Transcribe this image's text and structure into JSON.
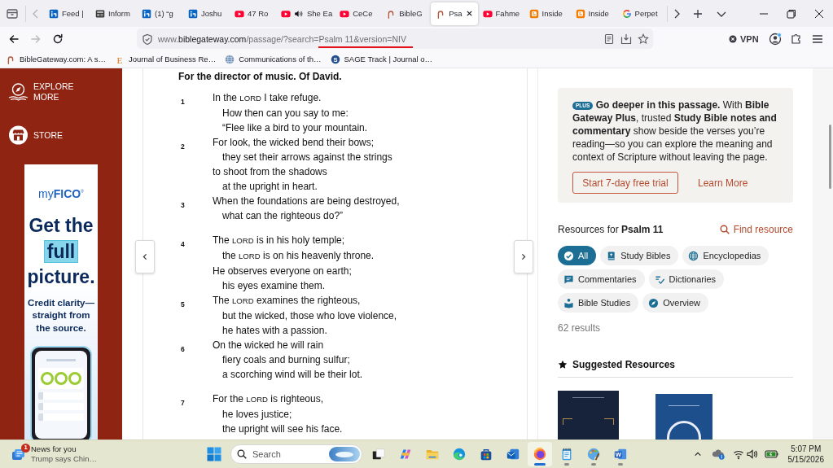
{
  "browser": {
    "tabs": [
      {
        "kind": "linkedin",
        "title": "Feed |",
        "selected": false,
        "audio": false
      },
      {
        "kind": "news",
        "title": "Inform",
        "selected": false,
        "audio": false
      },
      {
        "kind": "linkedin",
        "title": "(1) “g",
        "selected": false,
        "audio": false
      },
      {
        "kind": "linkedin",
        "title": "Joshu",
        "selected": false,
        "audio": false
      },
      {
        "kind": "youtube",
        "title": "47 Ro",
        "selected": false,
        "audio": false
      },
      {
        "kind": "youtube",
        "title": "She Ea",
        "selected": false,
        "audio": true
      },
      {
        "kind": "youtube",
        "title": "CeCe",
        "selected": false,
        "audio": false
      },
      {
        "kind": "biblegateway",
        "title": "BibleG",
        "selected": false,
        "audio": false
      },
      {
        "kind": "biblegateway",
        "title": "Psa",
        "selected": true,
        "audio": false
      },
      {
        "kind": "youtube",
        "title": "Fahme",
        "selected": false,
        "audio": false
      },
      {
        "kind": "blogger",
        "title": "Inside",
        "selected": false,
        "audio": false
      },
      {
        "kind": "blogger",
        "title": "Inside",
        "selected": false,
        "audio": false
      },
      {
        "kind": "google",
        "title": "Perpet",
        "selected": false,
        "audio": false
      }
    ],
    "nav_buttons": [
      {
        "kind": "back",
        "disabled": false
      },
      {
        "kind": "forward",
        "disabled": true
      },
      {
        "kind": "reload",
        "disabled": false
      }
    ],
    "address_bar": {
      "url_parts": [
        {
          "text": "www.",
          "kind": "muted",
          "underlined": false
        },
        {
          "text": "biblegateway.com",
          "kind": "domain",
          "underlined": false
        },
        {
          "text": "/passage/?search=",
          "kind": "muted",
          "underlined": false
        },
        {
          "text": "Psalm 11&version=NIV",
          "kind": "muted",
          "underlined": true
        }
      ]
    },
    "toolbar": {
      "vpn_label": "VPN",
      "account_badge": true
    },
    "bookmarks": [
      {
        "kind": "biblegateway",
        "title": "BibleGateway.com: A s…"
      },
      {
        "kind": "journal-e",
        "glyph": "E",
        "title": "Journal of Business Re…"
      },
      {
        "kind": "globe",
        "title": "Communications of th…"
      },
      {
        "kind": "sage",
        "glyph": "S",
        "title": "SAGE Track | Journal o…"
      }
    ]
  },
  "sidebar": {
    "items": [
      {
        "kind": "explore",
        "label": "EXPLORE MORE"
      },
      {
        "kind": "store",
        "label": "STORE"
      }
    ],
    "ad": {
      "brand": "my**FICO**$^{®}$",
      "headline": [
        {
          "text": "Get the",
          "highlight": false
        },
        {
          "text": "full",
          "highlight": true
        },
        {
          "text": "picture.",
          "highlight": false
        }
      ],
      "tagline": "Credit clarity—straight from the source."
    }
  },
  "passage": {
    "heading": "For the director of music. Of David.",
    "stanzas": [
      {
        "verses": [
          {
            "number": "1",
            "lines": [
              {
                "kind": "flush",
                "parts": [
                  {
                    "text": "In the ",
                    "kind": "plain"
                  },
                  {
                    "text": "LORD",
                    "kind": "divine-name"
                  },
                  {
                    "text": " I take refuge.",
                    "kind": "plain"
                  }
                ]
              },
              {
                "kind": "indented",
                "parts": [
                  {
                    "text": "How then can you say to me:",
                    "kind": "plain"
                  }
                ]
              },
              {
                "kind": "indented",
                "parts": [
                  {
                    "text": "“Flee like a bird to your mountain.",
                    "kind": "plain"
                  }
                ]
              }
            ]
          },
          {
            "number": "2",
            "lines": [
              {
                "kind": "flush",
                "parts": [
                  {
                    "text": "For look, the wicked bend their bows;",
                    "kind": "plain"
                  }
                ]
              },
              {
                "kind": "indented",
                "parts": [
                  {
                    "text": "they set their arrows against the strings",
                    "kind": "plain"
                  }
                ]
              },
              {
                "kind": "flush",
                "parts": [
                  {
                    "text": "to shoot from the shadows",
                    "kind": "plain"
                  }
                ]
              },
              {
                "kind": "indented",
                "parts": [
                  {
                    "text": "at the upright in heart.",
                    "kind": "plain"
                  }
                ]
              }
            ]
          },
          {
            "number": "3",
            "lines": [
              {
                "kind": "flush",
                "parts": [
                  {
                    "text": "When the foundations are being destroyed,",
                    "kind": "plain"
                  }
                ]
              },
              {
                "kind": "indented",
                "parts": [
                  {
                    "text": "what can the righteous do?”",
                    "kind": "plain"
                  }
                ]
              }
            ]
          }
        ]
      },
      {
        "verses": [
          {
            "number": "4",
            "lines": [
              {
                "kind": "flush",
                "parts": [
                  {
                    "text": "The ",
                    "kind": "plain"
                  },
                  {
                    "text": "LORD",
                    "kind": "divine-name"
                  },
                  {
                    "text": " is in his holy temple;",
                    "kind": "plain"
                  }
                ]
              },
              {
                "kind": "indented",
                "parts": [
                  {
                    "text": "the ",
                    "kind": "plain"
                  },
                  {
                    "text": "LORD",
                    "kind": "divine-name"
                  },
                  {
                    "text": " is on his heavenly throne.",
                    "kind": "plain"
                  }
                ]
              },
              {
                "kind": "flush",
                "parts": [
                  {
                    "text": "He observes everyone on earth;",
                    "kind": "plain"
                  }
                ]
              },
              {
                "kind": "indented",
                "parts": [
                  {
                    "text": "his eyes examine them.",
                    "kind": "plain"
                  }
                ]
              }
            ]
          },
          {
            "number": "5",
            "lines": [
              {
                "kind": "flush",
                "parts": [
                  {
                    "text": "The ",
                    "kind": "plain"
                  },
                  {
                    "text": "LORD",
                    "kind": "divine-name"
                  },
                  {
                    "text": " examines the righteous,",
                    "kind": "plain"
                  }
                ]
              },
              {
                "kind": "indented",
                "parts": [
                  {
                    "text": "but the wicked, those who love violence,",
                    "kind": "plain"
                  }
                ]
              },
              {
                "kind": "indented",
                "parts": [
                  {
                    "text": "he hates with a passion.",
                    "kind": "plain"
                  }
                ]
              }
            ]
          },
          {
            "number": "6",
            "lines": [
              {
                "kind": "flush",
                "parts": [
                  {
                    "text": "On the wicked he will rain",
                    "kind": "plain"
                  }
                ]
              },
              {
                "kind": "indented",
                "parts": [
                  {
                    "text": "fiery coals and burning sulfur;",
                    "kind": "plain"
                  }
                ]
              },
              {
                "kind": "indented",
                "parts": [
                  {
                    "text": "a scorching wind will be their lot.",
                    "kind": "plain"
                  }
                ]
              }
            ]
          }
        ]
      },
      {
        "verses": [
          {
            "number": "7",
            "lines": [
              {
                "kind": "flush",
                "parts": [
                  {
                    "text": "For the ",
                    "kind": "plain"
                  },
                  {
                    "text": "LORD",
                    "kind": "divine-name"
                  },
                  {
                    "text": " is righteous,",
                    "kind": "plain"
                  }
                ]
              },
              {
                "kind": "indented",
                "parts": [
                  {
                    "text": "he loves justice;",
                    "kind": "plain"
                  }
                ]
              },
              {
                "kind": "indented",
                "parts": [
                  {
                    "text": "the upright will see his face.",
                    "kind": "plain"
                  }
                ]
              }
            ]
          }
        ]
      }
    ]
  },
  "resources": {
    "promo": {
      "badge": "PLUS",
      "text": "**Go deeper in this passage.** With **Bible Gateway Plus**, trusted **Study Bible notes and commentary** show beside the verses you’re reading—so you can explore the meaning and context of Scripture without leaving the page.",
      "primary_button": "Start 7-day free trial",
      "link": "Learn More"
    },
    "heading": "Resources for **Psalm 11**",
    "find_link": "Find resource",
    "filters": [
      {
        "kind": "check",
        "label": "All",
        "selected": true
      },
      {
        "kind": "book",
        "label": "Study Bibles",
        "selected": false
      },
      {
        "kind": "globe",
        "label": "Encyclopedias",
        "selected": false
      },
      {
        "kind": "comment",
        "label": "Commentaries",
        "selected": false
      },
      {
        "kind": "dictionary",
        "label": "Dictionaries",
        "selected": false
      },
      {
        "kind": "reader",
        "label": "Bible Studies",
        "selected": false
      },
      {
        "kind": "compass",
        "label": "Overview",
        "selected": false
      }
    ],
    "results": "62 results",
    "suggested": {
      "title": "Suggested Resources",
      "items": [
        {
          "kind": "ornate"
        },
        {
          "kind": "emblem"
        }
      ]
    }
  },
  "taskbar": {
    "news": {
      "badge": "1",
      "title": "News for you",
      "subtitle": "Trump says Chin…"
    },
    "search": {
      "placeholder": "Search"
    },
    "apps": [
      {
        "kind": "task-view",
        "running": false,
        "selected": false
      },
      {
        "kind": "copilot",
        "running": false,
        "selected": false
      },
      {
        "kind": "explorer",
        "running": false,
        "selected": false
      },
      {
        "kind": "edge",
        "running": false,
        "selected": false
      },
      {
        "kind": "store",
        "running": false,
        "selected": false
      },
      {
        "kind": "outlook",
        "running": false,
        "selected": false
      },
      {
        "kind": "firefox",
        "running": true,
        "selected": true
      },
      {
        "kind": "notepad",
        "running": true,
        "selected": false
      },
      {
        "kind": "paint",
        "running": true,
        "selected": false
      },
      {
        "kind": "word",
        "glyph": "W",
        "running": true,
        "selected": false
      }
    ],
    "clock": {
      "time": "5:07 PM",
      "date": "5/15/2026"
    }
  }
}
